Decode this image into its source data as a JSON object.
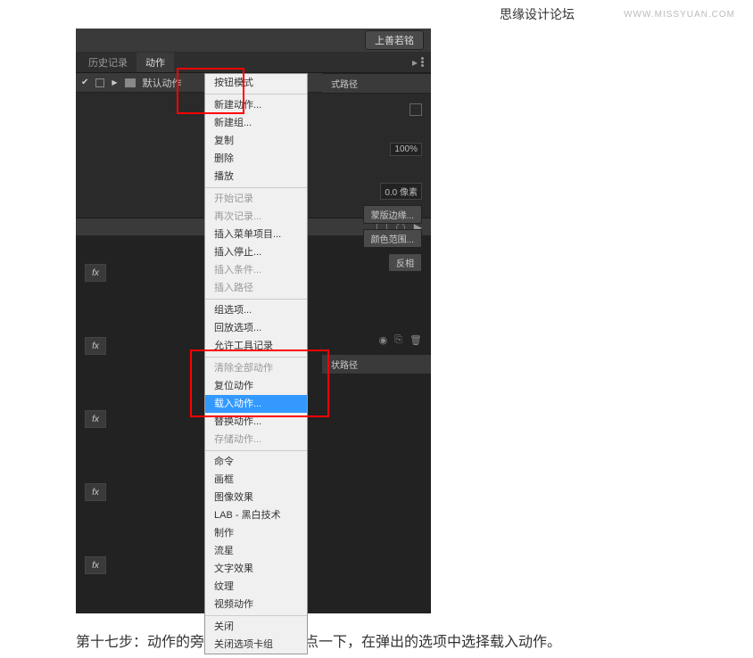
{
  "topbar": {
    "left": "思缘设计论坛",
    "right": "WWW.MISSYUAN.COM"
  },
  "titlebar": {
    "button": "上善若铭"
  },
  "tabs": {
    "history": "历史记录",
    "actions": "动作"
  },
  "action_set": {
    "name": "默认动作"
  },
  "right_panel": {
    "path_label": "式路径",
    "opacity": "100%",
    "feather": "0.0 像素",
    "refine": "蒙版边缘...",
    "color_range": "颜色范围...",
    "invert": "反相",
    "path2": "状路径"
  },
  "menu": {
    "items": [
      {
        "t": "按钮模式",
        "type": "item"
      },
      {
        "type": "sep"
      },
      {
        "t": "新建动作...",
        "type": "item"
      },
      {
        "t": "新建组...",
        "type": "item"
      },
      {
        "t": "复制",
        "type": "item"
      },
      {
        "t": "删除",
        "type": "item"
      },
      {
        "t": "播放",
        "type": "item"
      },
      {
        "type": "sep"
      },
      {
        "t": "开始记录",
        "type": "disabled"
      },
      {
        "t": "再次记录...",
        "type": "disabled"
      },
      {
        "t": "插入菜单项目...",
        "type": "item"
      },
      {
        "t": "插入停止...",
        "type": "item"
      },
      {
        "t": "插入条件...",
        "type": "disabled"
      },
      {
        "t": "插入路径",
        "type": "disabled"
      },
      {
        "type": "sep"
      },
      {
        "t": "组选项...",
        "type": "item"
      },
      {
        "t": "回放选项...",
        "type": "item"
      },
      {
        "t": "允许工具记录",
        "type": "item"
      },
      {
        "type": "sep"
      },
      {
        "t": "清除全部动作",
        "type": "disabled"
      },
      {
        "t": "复位动作",
        "type": "item"
      },
      {
        "t": "载入动作...",
        "type": "highlighted"
      },
      {
        "t": "替换动作...",
        "type": "item"
      },
      {
        "t": "存储动作...",
        "type": "disabled"
      },
      {
        "type": "sep"
      },
      {
        "t": "命令",
        "type": "item"
      },
      {
        "t": "画框",
        "type": "item"
      },
      {
        "t": "图像效果",
        "type": "item"
      },
      {
        "t": "LAB - 黑白技术",
        "type": "item"
      },
      {
        "t": "制作",
        "type": "item"
      },
      {
        "t": "流星",
        "type": "item"
      },
      {
        "t": "文字效果",
        "type": "item"
      },
      {
        "t": "纹理",
        "type": "item"
      },
      {
        "t": "视频动作",
        "type": "item"
      },
      {
        "type": "sep"
      },
      {
        "t": "关闭",
        "type": "item"
      },
      {
        "t": "关闭选项卡组",
        "type": "item"
      }
    ]
  },
  "fx": "fx",
  "caption": "第十七步：动作的旁边的小三角形，点一下，在弹出的选项中选择载入动作。"
}
